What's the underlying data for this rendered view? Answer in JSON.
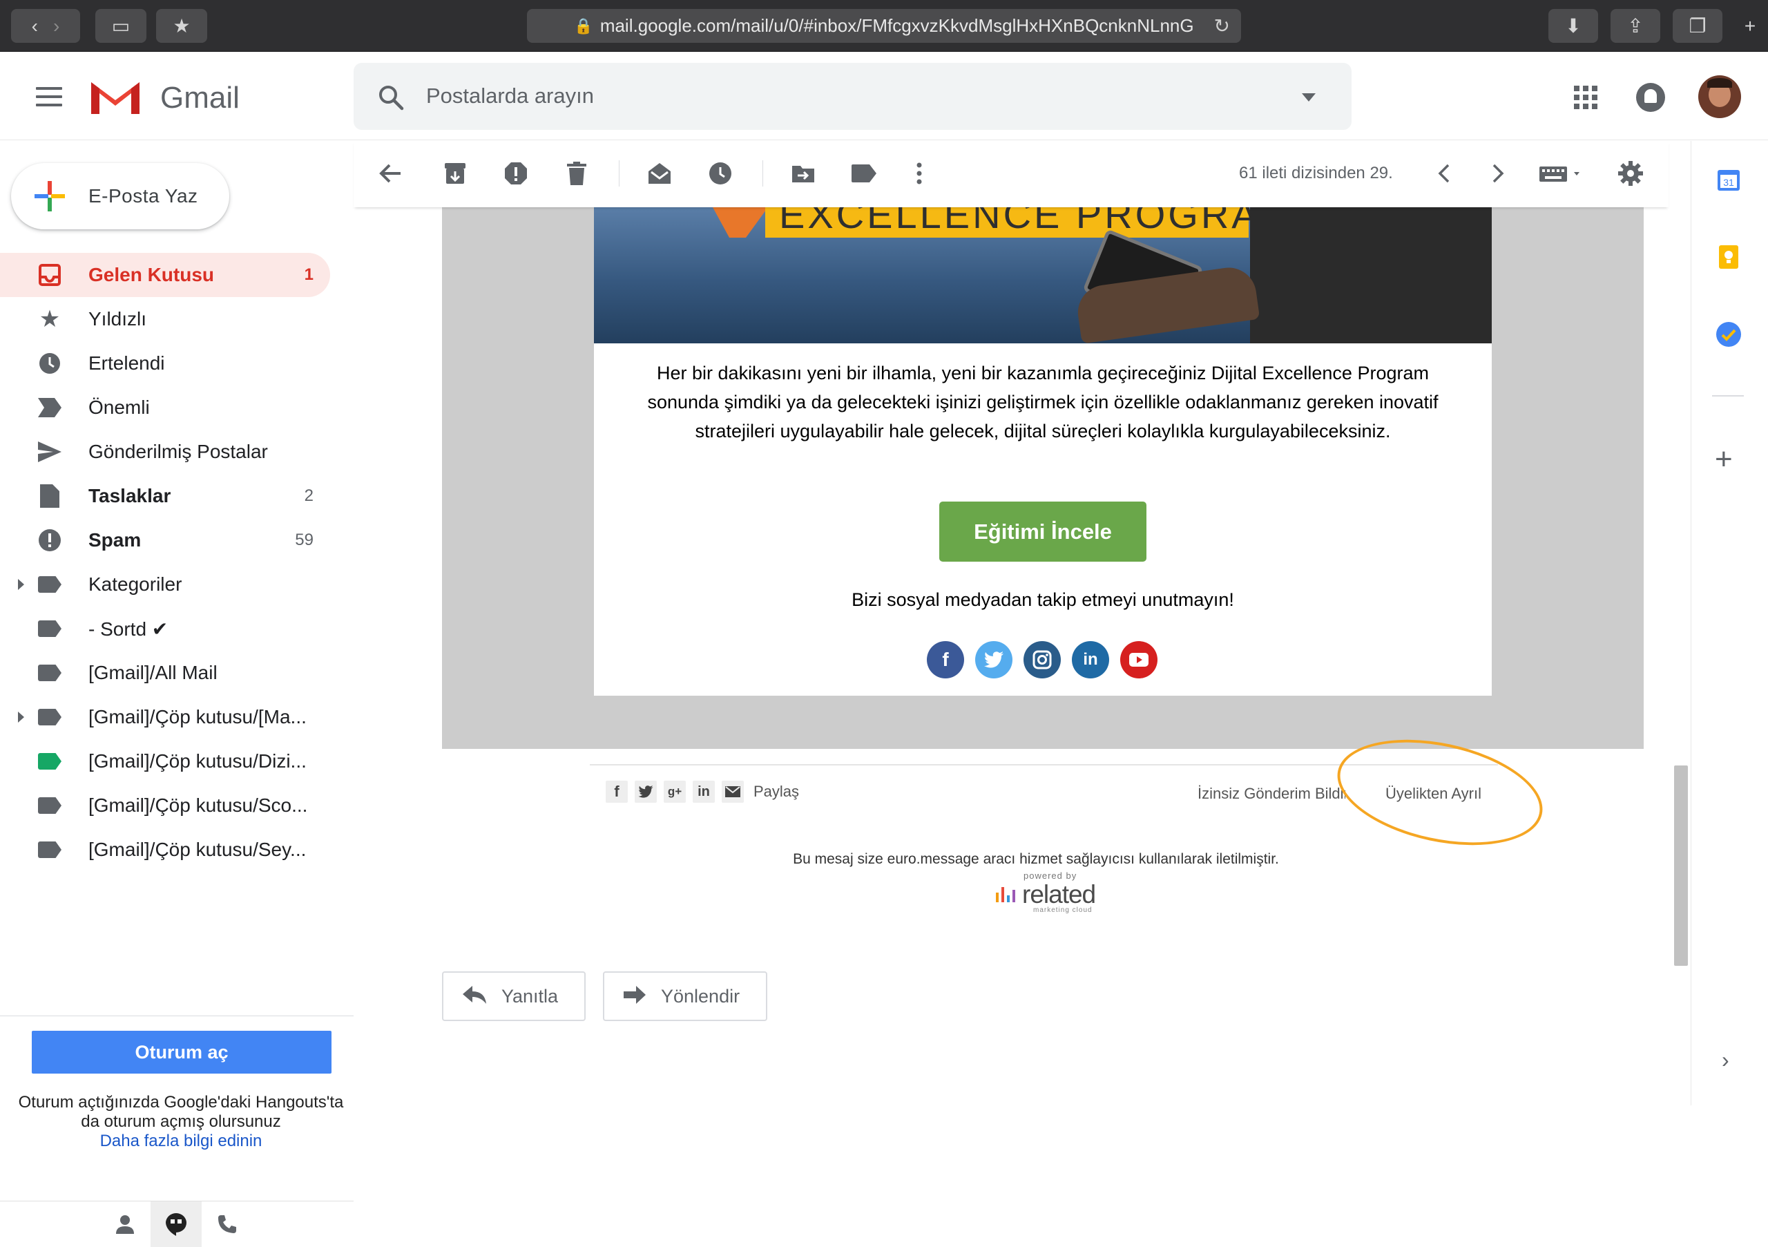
{
  "browser": {
    "url": "mail.google.com/mail/u/0/#inbox/FMfcgxvzKkvdMsglHxHXnBQcnknNLnnG"
  },
  "header": {
    "app_name": "Gmail",
    "search_placeholder": "Postalarda arayın"
  },
  "sidebar": {
    "compose_label": "E-Posta Yaz",
    "items": [
      {
        "label": "Gelen Kutusu",
        "count": "1",
        "icon": "inbox-icon",
        "active": true
      },
      {
        "label": "Yıldızlı",
        "count": "",
        "icon": "star-icon"
      },
      {
        "label": "Ertelendi",
        "count": "",
        "icon": "clock-icon"
      },
      {
        "label": "Önemli",
        "count": "",
        "icon": "important-icon"
      },
      {
        "label": "Gönderilmiş Postalar",
        "count": "",
        "icon": "send-icon"
      },
      {
        "label": "Taslaklar",
        "count": "2",
        "icon": "draft-icon",
        "bold": true
      },
      {
        "label": "Spam",
        "count": "59",
        "icon": "spam-icon",
        "bold": true
      },
      {
        "label": "Kategoriler",
        "count": "",
        "icon": "label-icon",
        "expandable": true
      },
      {
        "label": "- Sortd ✔",
        "count": "",
        "icon": "label-icon"
      },
      {
        "label": "[Gmail]/All Mail",
        "count": "",
        "icon": "label-icon"
      },
      {
        "label": "[Gmail]/Çöp kutusu/[Ma...",
        "count": "",
        "icon": "label-icon",
        "expandable": true
      },
      {
        "label": "[Gmail]/Çöp kutusu/Dizi...",
        "count": "",
        "icon": "label-icon",
        "color": "#16a765"
      },
      {
        "label": "[Gmail]/Çöp kutusu/Sco...",
        "count": "",
        "icon": "label-icon"
      },
      {
        "label": "[Gmail]/Çöp kutusu/Sey...",
        "count": "",
        "icon": "label-icon"
      }
    ],
    "login_button": "Oturum aç",
    "hangouts_message": "Oturum açtığınızda Google'daki Hangouts'ta da oturum açmış olursunuz",
    "hangouts_link": "Daha fazla bilgi edinin"
  },
  "toolbar": {
    "pagination": "61 ileti dizisinden 29."
  },
  "email": {
    "banner_text": "EXCELLENCE PROGRAM",
    "body_text": "Her bir dakikasını yeni bir ilhamla, yeni bir kazanımla geçireceğiniz Dijital Excellence Program sonunda şimdiki ya da gelecekteki işinizi geliştirmek için özellikle odaklanmanız gereken inovatif stratejileri uygulayabilir hale gelecek, dijital süreçleri kolaylıkla kurgulayabileceksiniz.",
    "cta_label": "Eğitimi İncele",
    "social_text": "Bizi sosyal medyadan takip etmeyi unutmayın!",
    "social_icons": [
      {
        "name": "facebook",
        "glyph": "f",
        "color": "#3b5998"
      },
      {
        "name": "twitter",
        "glyph": "t",
        "color": "#55acee"
      },
      {
        "name": "instagram",
        "glyph": "◎",
        "color": "#2a5c8a"
      },
      {
        "name": "linkedin",
        "glyph": "in",
        "color": "#1f6aa5"
      },
      {
        "name": "youtube",
        "glyph": "▶",
        "color": "#d6201f"
      }
    ],
    "share_label": "Paylaş",
    "unsolicited_label": "İzinsiz Gönderim Bildir",
    "unsubscribe_label": "Üyelikten Ayrıl",
    "euro_message": "Bu mesaj size euro.message aracı hizmet sağlayıcısı kullanılarak iletilmiştir.",
    "powered_by": "powered by",
    "related_word": "related",
    "related_sub": "marketing cloud",
    "reply_label": "Yanıtla",
    "forward_label": "Yönlendir"
  },
  "right_panel": {
    "calendar_day": "31"
  },
  "colors": {
    "gmail_red": "#d93025",
    "cta_green": "#6aa74a",
    "highlight_orange": "#f5a623",
    "login_blue": "#4285f4"
  }
}
